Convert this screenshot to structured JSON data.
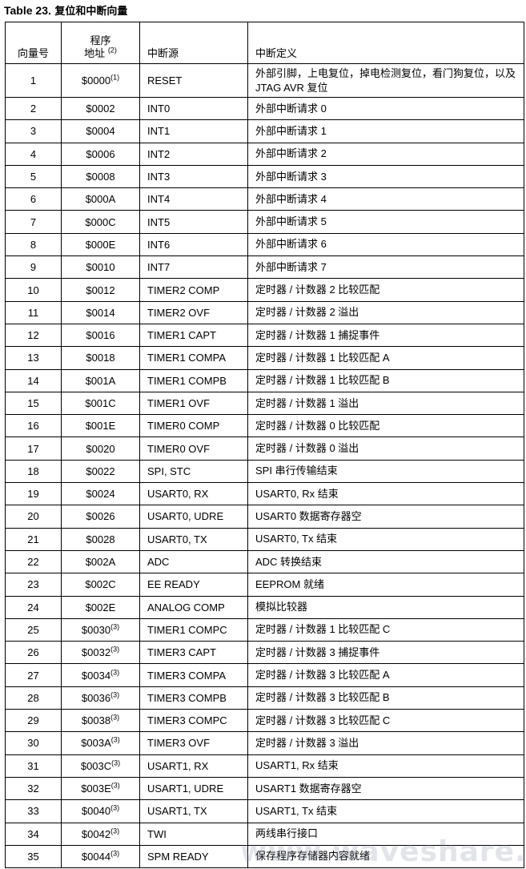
{
  "caption": {
    "label": "Table 23.",
    "title": "复位和中断向量"
  },
  "headers": {
    "vector_no": "向量号",
    "address_line1": "程序",
    "address_line2": "地址",
    "address_note": "(2)",
    "source": "中断源",
    "definition": "中断定义"
  },
  "rows": [
    {
      "no": "1",
      "addr": "$0000",
      "note": "(1)",
      "src": "RESET",
      "def": "外部引脚，上电复位，掉电检测复位，看门狗复位，以及 JTAG AVR 复位"
    },
    {
      "no": "2",
      "addr": "$0002",
      "note": "",
      "src": "INT0",
      "def": "外部中断请求 0"
    },
    {
      "no": "3",
      "addr": "$0004",
      "note": "",
      "src": "INT1",
      "def": "外部中断请求 1"
    },
    {
      "no": "4",
      "addr": "$0006",
      "note": "",
      "src": "INT2",
      "def": "外部中断请求 2"
    },
    {
      "no": "5",
      "addr": "$0008",
      "note": "",
      "src": "INT3",
      "def": "外部中断请求 3"
    },
    {
      "no": "6",
      "addr": "$000A",
      "note": "",
      "src": "INT4",
      "def": "外部中断请求 4"
    },
    {
      "no": "7",
      "addr": "$000C",
      "note": "",
      "src": "INT5",
      "def": "外部中断请求 5"
    },
    {
      "no": "8",
      "addr": "$000E",
      "note": "",
      "src": "INT6",
      "def": "外部中断请求 6"
    },
    {
      "no": "9",
      "addr": "$0010",
      "note": "",
      "src": "INT7",
      "def": "外部中断请求 7"
    },
    {
      "no": "10",
      "addr": "$0012",
      "note": "",
      "src": "TIMER2 COMP",
      "def": "定时器 / 计数器 2 比较匹配"
    },
    {
      "no": "11",
      "addr": "$0014",
      "note": "",
      "src": "TIMER2 OVF",
      "def": "定时器 / 计数器 2 溢出"
    },
    {
      "no": "12",
      "addr": "$0016",
      "note": "",
      "src": "TIMER1 CAPT",
      "def": "定时器 / 计数器 1 捕捉事件"
    },
    {
      "no": "13",
      "addr": "$0018",
      "note": "",
      "src": "TIMER1 COMPA",
      "def": "定时器 / 计数器 1 比较匹配 A"
    },
    {
      "no": "14",
      "addr": "$001A",
      "note": "",
      "src": "TIMER1 COMPB",
      "def": "定时器 / 计数器 1 比较匹配 B"
    },
    {
      "no": "15",
      "addr": "$001C",
      "note": "",
      "src": "TIMER1 OVF",
      "def": "定时器 / 计数器 1 溢出"
    },
    {
      "no": "16",
      "addr": "$001E",
      "note": "",
      "src": "TIMER0 COMP",
      "def": "定时器 / 计数器 0 比较匹配"
    },
    {
      "no": "17",
      "addr": "$0020",
      "note": "",
      "src": "TIMER0 OVF",
      "def": "定时器 / 计数器 0 溢出"
    },
    {
      "no": "18",
      "addr": "$0022",
      "note": "",
      "src": "SPI, STC",
      "def": "SPI 串行传输结束"
    },
    {
      "no": "19",
      "addr": "$0024",
      "note": "",
      "src": "USART0, RX",
      "def": "USART0, Rx 结束"
    },
    {
      "no": "20",
      "addr": "$0026",
      "note": "",
      "src": "USART0, UDRE",
      "def": "USART0 数据寄存器空"
    },
    {
      "no": "21",
      "addr": "$0028",
      "note": "",
      "src": "USART0, TX",
      "def": "USART0, Tx 结束"
    },
    {
      "no": "22",
      "addr": "$002A",
      "note": "",
      "src": "ADC",
      "def": "ADC 转换结束"
    },
    {
      "no": "23",
      "addr": "$002C",
      "note": "",
      "src": "EE READY",
      "def": "EEPROM 就绪"
    },
    {
      "no": "24",
      "addr": "$002E",
      "note": "",
      "src": "ANALOG COMP",
      "def": "模拟比较器"
    },
    {
      "no": "25",
      "addr": "$0030",
      "note": "(3)",
      "src": "TIMER1 COMPC",
      "def": "定时器 / 计数器 1 比较匹配 C"
    },
    {
      "no": "26",
      "addr": "$0032",
      "note": "(3)",
      "src": "TIMER3 CAPT",
      "def": "定时器 / 计数器 3 捕捉事件"
    },
    {
      "no": "27",
      "addr": "$0034",
      "note": "(3)",
      "src": "TIMER3 COMPA",
      "def": "定时器 / 计数器 3 比较匹配 A"
    },
    {
      "no": "28",
      "addr": "$0036",
      "note": "(3)",
      "src": "TIMER3 COMPB",
      "def": "定时器 / 计数器 3 比较匹配 B"
    },
    {
      "no": "29",
      "addr": "$0038",
      "note": "(3)",
      "src": "TIMER3 COMPC",
      "def": "定时器 / 计数器 3 比较匹配 C"
    },
    {
      "no": "30",
      "addr": "$003A",
      "note": "(3)",
      "src": "TIMER3 OVF",
      "def": "定时器 / 计数器 3 溢出"
    },
    {
      "no": "31",
      "addr": "$003C",
      "note": "(3)",
      "src": "USART1, RX",
      "def": "USART1, Rx 结束"
    },
    {
      "no": "32",
      "addr": "$003E",
      "note": "(3)",
      "src": "USART1, UDRE",
      "def": "USART1 数据寄存器空"
    },
    {
      "no": "33",
      "addr": "$0040",
      "note": "(3)",
      "src": "USART1, TX",
      "def": "USART1, Tx 结束"
    },
    {
      "no": "34",
      "addr": "$0042",
      "note": "(3)",
      "src": "TWI",
      "def": "两线串行接口"
    },
    {
      "no": "35",
      "addr": "$0044",
      "note": "(3)",
      "src": "SPM READY",
      "def": "保存程序存储器内容就绪"
    }
  ],
  "watermark": "www.waveshare.net"
}
